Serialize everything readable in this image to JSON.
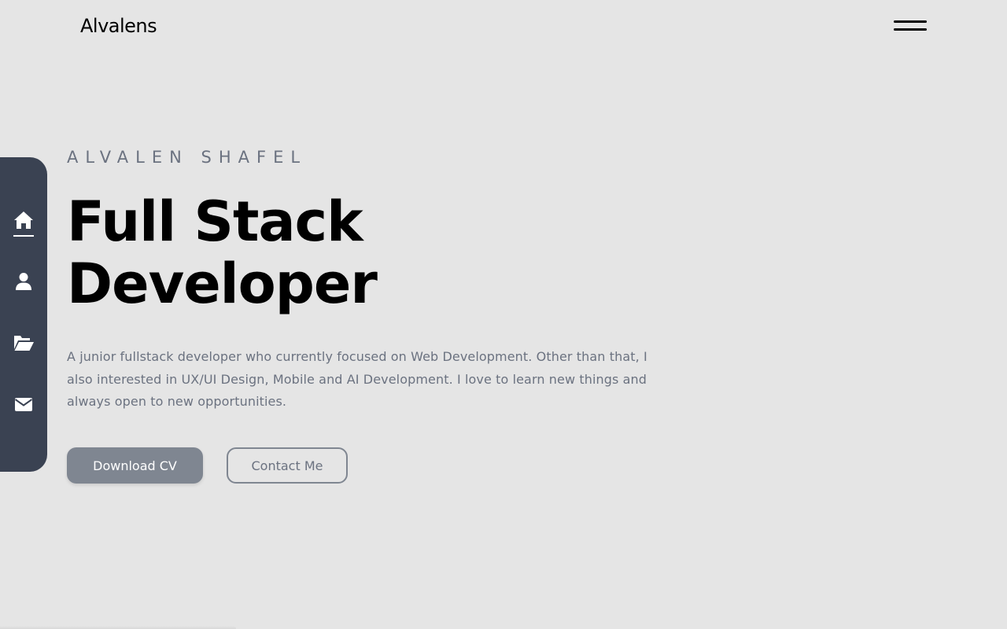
{
  "header": {
    "brand": "Alvalens",
    "menu_icon": "hamburger-menu-icon"
  },
  "sidebar": {
    "background": "#3a4252",
    "items": [
      {
        "id": "home",
        "icon": "home-icon",
        "active": true
      },
      {
        "id": "about",
        "icon": "user-icon",
        "active": false
      },
      {
        "id": "projects",
        "icon": "folder-open-icon",
        "active": false
      },
      {
        "id": "contact",
        "icon": "envelope-icon",
        "active": false
      }
    ]
  },
  "hero": {
    "subtitle": "ALVALEN SHAFEL",
    "title_line1": "Full Stack",
    "title_line2": "Developer",
    "description": "A junior fullstack developer who currently focused on Web Development. Other than that, I also interested in UX/UI Design, Mobile and AI Development. I love to learn new things and always open to new opportunities.",
    "download_label": "Download CV",
    "contact_label": "Contact Me"
  },
  "colors": {
    "background": "#e5e5e5",
    "muted_text": "#6b7280",
    "primary_button": "#7f8691"
  }
}
